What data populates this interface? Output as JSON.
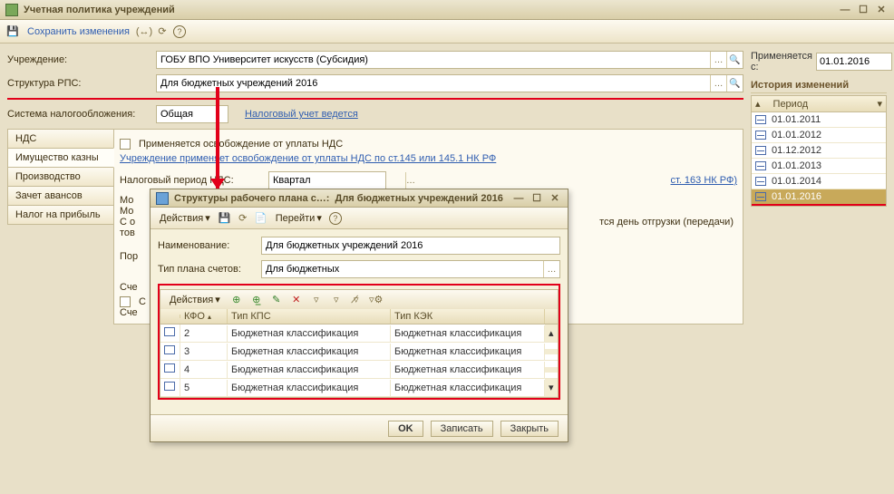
{
  "window": {
    "title": "Учетная политика учреждений"
  },
  "toolbar": {
    "save_label": "Сохранить изменения"
  },
  "form": {
    "institution_label": "Учреждение:",
    "institution_value": "ГОБУ ВПО Университет искусств (Субсидия)",
    "rps_label": "Структура РПС:",
    "rps_value": "Для бюджетных учреждений 2016",
    "taxsys_label": "Система налогообложения:",
    "taxsys_value": "Общая",
    "tax_link": "Налоговый учет ведется"
  },
  "tabs": [
    "НДС",
    "Имущество казны",
    "Производство",
    "Зачет авансов",
    "Налог на прибыль"
  ],
  "nds": {
    "exempt_cb_label": "Применяется освобождение от уплаты НДС",
    "exempt_link": "Учреждение применяет освобождение от уплаты НДС по ст.145 или 145.1 НК РФ",
    "period_label": "Налоговый период    НДС:",
    "period_value": "Квартал",
    "st163_tail": "ст. 163 НК РФ)",
    "mo_prefix": "Мо",
    "line3_pre": "Мо",
    "line4_pre": "С о",
    "line5_pre": "тов",
    "ship_tail": "тся день отгрузки (передачи)",
    "por": "Пор",
    "sch1": "Сче",
    "sch_cb": "С",
    "sch2": "Сче"
  },
  "right": {
    "applies_label": "Применяется с:",
    "applies_value": "01.01.2016",
    "history_title": "История изменений",
    "period_head": "Период",
    "items": [
      "01.01.2011",
      "01.01.2012",
      "01.12.2012",
      "01.01.2013",
      "01.01.2014",
      "01.01.2016"
    ],
    "selected_index": 5
  },
  "popup": {
    "title_left": "Структуры рабочего плана с…:",
    "title_right": "Для бюджетных учреждений 2016",
    "actions_label": "Действия",
    "goto_label": "Перейти",
    "name_label": "Наименование:",
    "name_value": "Для бюджетных учреждений 2016",
    "plantype_label": "Тип плана счетов:",
    "plantype_value": "Для бюджетных",
    "grid": {
      "headers": [
        "",
        "КФО",
        "Тип КПС",
        "Тип КЭК"
      ],
      "rows": [
        {
          "kfo": "2",
          "kps": "Бюджетная классификация",
          "kek": "Бюджетная классификация"
        },
        {
          "kfo": "3",
          "kps": "Бюджетная классификация",
          "kek": "Бюджетная классификация"
        },
        {
          "kfo": "4",
          "kps": "Бюджетная классификация",
          "kek": "Бюджетная классификация"
        },
        {
          "kfo": "5",
          "kps": "Бюджетная классификация",
          "kek": "Бюджетная классификация"
        }
      ]
    },
    "ok_label": "OK",
    "save_label": "Записать",
    "close_label": "Закрыть"
  }
}
